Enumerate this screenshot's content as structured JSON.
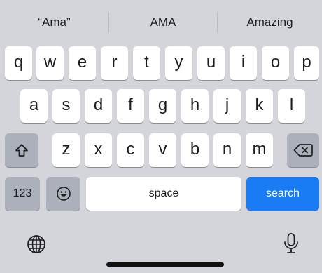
{
  "suggestions": [
    "“Ama”",
    "AMA",
    "Amazing"
  ],
  "rows": {
    "row1": [
      "q",
      "w",
      "e",
      "r",
      "t",
      "y",
      "u",
      "i",
      "o",
      "p"
    ],
    "row2": [
      "a",
      "s",
      "d",
      "f",
      "g",
      "h",
      "j",
      "k",
      "l"
    ],
    "row3": [
      "z",
      "x",
      "c",
      "v",
      "b",
      "n",
      "m"
    ]
  },
  "keys": {
    "shift_icon": "shift-arrow-icon",
    "delete_icon": "delete-backward-icon",
    "numbers_label": "123",
    "emoji_icon": "emoji-face-icon",
    "space_label": "space",
    "search_label": "search",
    "globe_icon": "globe-icon",
    "mic_icon": "microphone-icon"
  },
  "colors": {
    "keyboard_bg": "#d3d5db",
    "key_bg": "#ffffff",
    "special_key_bg": "#abb0ba",
    "search_key_bg": "#1a7cf5",
    "search_key_text": "#ffffff"
  }
}
